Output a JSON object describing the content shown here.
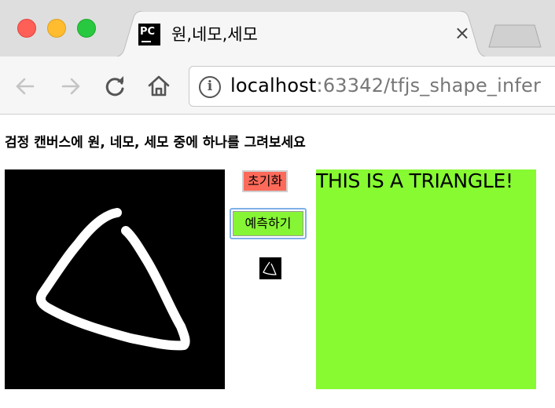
{
  "browser": {
    "tab_title": "원,네모,세모",
    "favicon_text": "PC",
    "close_symbol": "×",
    "url_host": "localhost",
    "url_rest": ":63342/tfjs_shape_infer",
    "info_symbol": "i"
  },
  "page": {
    "heading": "검정 캔버스에 원, 네모, 세모 중에 하나를 그려보세요",
    "reset_label": "초기화",
    "predict_label": "예측하기",
    "result_text": "THIS IS A TRIANGLE!"
  },
  "colors": {
    "reset_bg": "#fd6a5a",
    "predict_bg": "#86f535",
    "result_bg": "#87fa32",
    "canvas_bg": "#000000",
    "stroke": "#ffffff"
  },
  "icons": [
    "back-arrow-icon",
    "forward-arrow-icon",
    "reload-icon",
    "home-icon",
    "info-icon",
    "close-icon"
  ]
}
